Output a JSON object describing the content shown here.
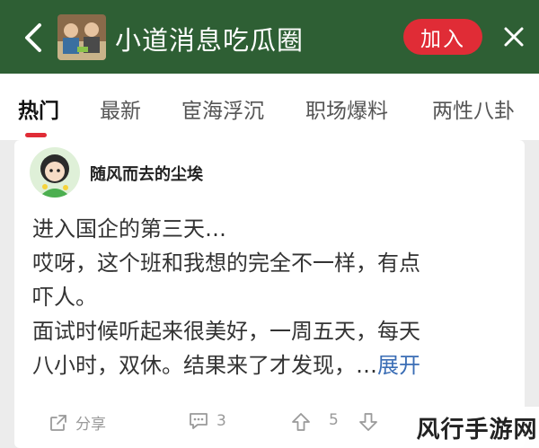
{
  "header": {
    "title": "小道消息吃瓜圈",
    "join_label": "加入",
    "back_icon": "chevron-left-icon",
    "more_icon": "close-icon",
    "bg_color": "#2e5f34",
    "accent_color": "#e02c36"
  },
  "tabs": [
    {
      "label": "热门",
      "active": true
    },
    {
      "label": "最新"
    },
    {
      "label": "宦海浮沉"
    },
    {
      "label": "职场爆料"
    },
    {
      "label": "两性八卦"
    }
  ],
  "post": {
    "username": "随风而去的尘埃",
    "lines": [
      "进入国企的第三天…",
      "哎呀，这个班和我想的完全不一样，有点",
      "吓人。",
      "面试时候听起来很美好，一周五天，每天",
      "八小时，双休。结果来了才发现，…"
    ],
    "expand_label": "展开",
    "actions": {
      "share_label": "分享",
      "comment_count": "3",
      "vote_count": "5"
    }
  },
  "watermark": "风行手游网"
}
